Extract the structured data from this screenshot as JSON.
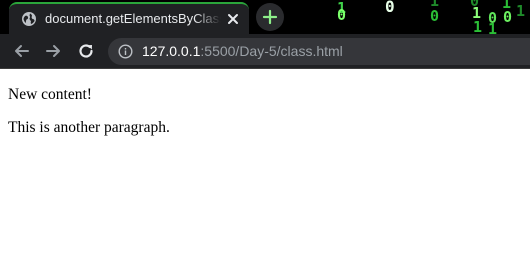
{
  "browser": {
    "tab": {
      "title": "document.getElementsByClassName",
      "favicon": "globe-icon",
      "close_icon": "close-icon",
      "active_accent": "#2aa53a"
    },
    "new_tab_icon": "plus-icon",
    "toolbar": {
      "back_icon": "arrow-left-icon",
      "forward_icon": "arrow-right-icon",
      "reload_icon": "reload-icon",
      "info_icon": "info-icon",
      "url_host": "127.0.0.1",
      "url_path": ":5500/Day-5/class.html"
    },
    "theme_background": {
      "style": "matrix digital rain",
      "glyphs": [
        "1",
        "0",
        "0",
        "1",
        "0",
        "1",
        "0",
        "1",
        "1",
        "0",
        "1",
        "0"
      ]
    }
  },
  "page": {
    "paragraphs": [
      "New content!",
      "This is another paragraph."
    ]
  }
}
